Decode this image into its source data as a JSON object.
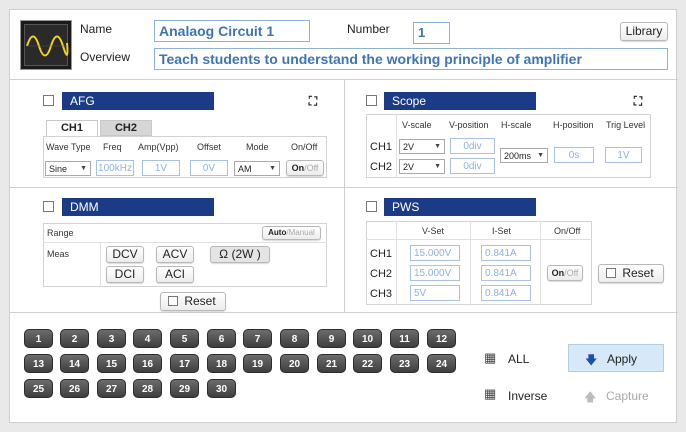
{
  "header": {
    "name_label": "Name",
    "name_value": "Analaog Circuit 1",
    "number_label": "Number",
    "number_value": "1",
    "library_button": "Library",
    "overview_label": "Overview",
    "overview_value": "Teach students to understand the working principle of amplifier"
  },
  "afg": {
    "title": "AFG",
    "tabs": [
      "CH1",
      "CH2"
    ],
    "columns": [
      "Wave Type",
      "Freq",
      "Amp(Vpp)",
      "Offset",
      "Mode",
      "On/Off"
    ],
    "wave_type": "Sine",
    "freq": "100kHz",
    "amp": "1V",
    "offset": "0V",
    "mode": "AM",
    "onoff_on": "On",
    "onoff_off": "Off"
  },
  "scope": {
    "title": "Scope",
    "columns": [
      "V-scale",
      "V-position",
      "H-scale",
      "H-position",
      "Trig Level"
    ],
    "channels": [
      {
        "label": "CH1",
        "vscale": "2V",
        "vpos": "0div"
      },
      {
        "label": "CH2",
        "vscale": "2V",
        "vpos": "0div"
      }
    ],
    "hscale": "200ms",
    "hpos": "0s",
    "trig": "1V"
  },
  "dmm": {
    "title": "DMM",
    "range_label": "Range",
    "auto_label": "Auto",
    "manual_label": "Manual",
    "meas_label": "Meas",
    "buttons": [
      "DCV",
      "ACV",
      "Ω (2W )",
      "DCI",
      "ACI"
    ],
    "reset": "Reset"
  },
  "pws": {
    "title": "PWS",
    "columns": [
      "V-Set",
      "I-Set",
      "On/Off"
    ],
    "channels": [
      {
        "label": "CH1",
        "vset": "15.000V",
        "iset": "0.841A"
      },
      {
        "label": "CH2",
        "vset": "15.000V",
        "iset": "0.841A"
      },
      {
        "label": "CH3",
        "vset": "5V",
        "iset": "0.841A"
      }
    ],
    "onoff_on": "On",
    "onoff_off": "Off",
    "reset": "Reset"
  },
  "stations": [
    "1",
    "2",
    "3",
    "4",
    "5",
    "6",
    "7",
    "8",
    "9",
    "10",
    "11",
    "12",
    "13",
    "14",
    "15",
    "16",
    "17",
    "18",
    "19",
    "20",
    "21",
    "22",
    "23",
    "24",
    "25",
    "26",
    "27",
    "28",
    "29",
    "30"
  ],
  "controls": {
    "all": "ALL",
    "inverse": "Inverse",
    "apply": "Apply",
    "capture": "Capture"
  },
  "colors": {
    "titlebar": "#1c3b86",
    "field_text": "#8eb2dd",
    "station_button": "#4a4a4a",
    "apply_bg": "#d7e8f8"
  }
}
